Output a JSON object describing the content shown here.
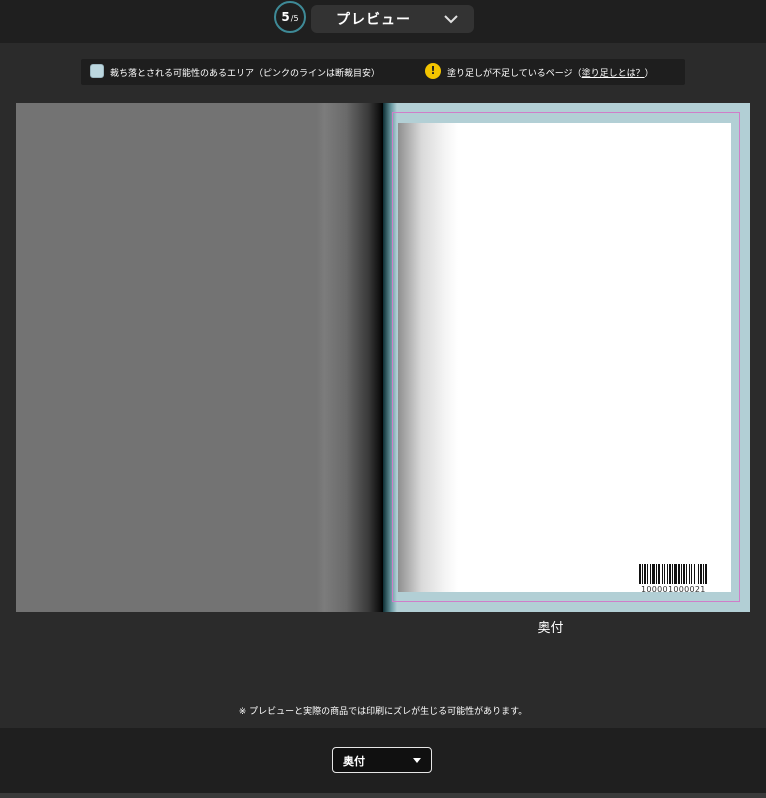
{
  "header": {
    "step_current": "5",
    "step_total": "/5",
    "title": "プレビュー",
    "chevron_icon": "chevron-down-icon",
    "accent_color": "#3e8a97"
  },
  "notice": {
    "crop_area_text": "裁ち落とされる可能性のあるエリア（ピンクのラインは断裁目安）",
    "crop_swatch_color": "#bcd7df",
    "bleed_warning_icon": "!",
    "bleed_warning_prefix": "塗り足しが不足しているページ（",
    "bleed_link": "塗り足しとは？",
    "bleed_warning_suffix": "）",
    "warning_color": "#f3c400",
    "trim_line_color": "#cf7ec8"
  },
  "preview": {
    "barcode_number": "100001000021",
    "page_caption": "奥付"
  },
  "disclaimer": "※ プレビューと実際の商品では印刷にズレが生じる可能性があります。",
  "footer": {
    "page_select_value": "奥付"
  }
}
